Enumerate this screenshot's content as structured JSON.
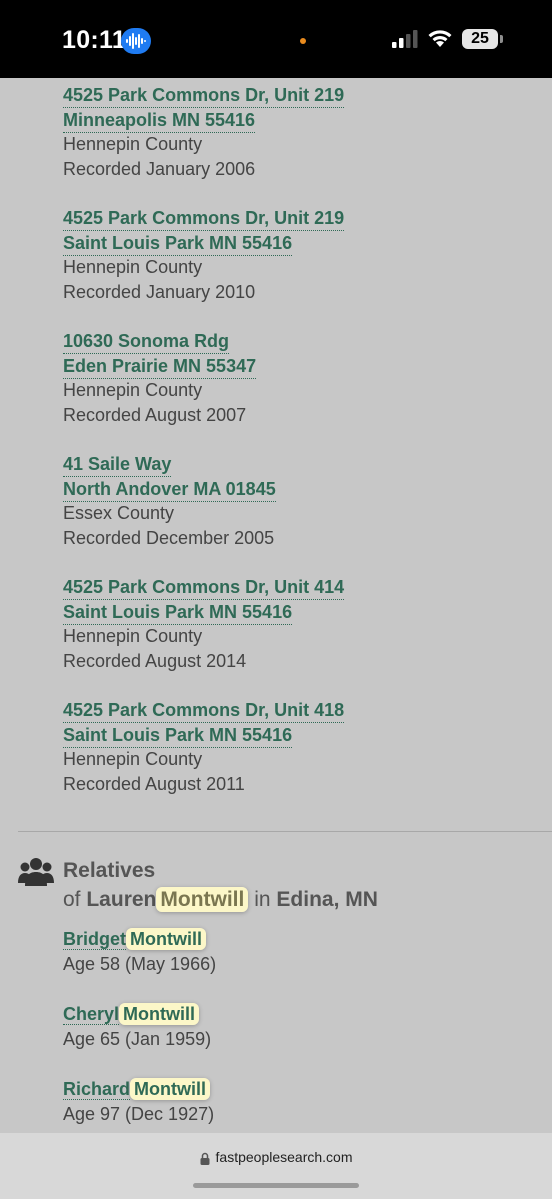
{
  "status_bar": {
    "time": "10:11",
    "battery": "25",
    "accent_color": "#1f7bf2"
  },
  "addresses": [
    {
      "line1": "4525 Park Commons Dr, Unit 219",
      "line2": "Minneapolis MN 55416",
      "county": "Hennepin County",
      "recorded": "Recorded January 2006"
    },
    {
      "line1": "4525 Park Commons Dr, Unit 219",
      "line2": "Saint Louis Park MN 55416",
      "county": "Hennepin County",
      "recorded": "Recorded January 2010"
    },
    {
      "line1": "10630 Sonoma Rdg",
      "line2": "Eden Prairie MN 55347",
      "county": "Hennepin County",
      "recorded": "Recorded August 2007"
    },
    {
      "line1": "41 Saile Way",
      "line2": "North Andover MA 01845",
      "county": "Essex County",
      "recorded": "Recorded December 2005"
    },
    {
      "line1": "4525 Park Commons Dr, Unit 414",
      "line2": "Saint Louis Park MN 55416",
      "county": "Hennepin County",
      "recorded": "Recorded August 2014"
    },
    {
      "line1": "4525 Park Commons Dr, Unit 418",
      "line2": "Saint Louis Park MN 55416",
      "county": "Hennepin County",
      "recorded": "Recorded August 2011"
    }
  ],
  "relatives_section": {
    "title": "Relatives",
    "sub_prefix": "of",
    "first_name": "Lauren",
    "last_name": "Montwill",
    "sub_mid": "in",
    "location": "Edina, MN"
  },
  "relatives": [
    {
      "first": "Bridget",
      "last": "Montwill",
      "age": "Age 58 (May 1966)"
    },
    {
      "first": "Cheryl",
      "last": "Montwill",
      "age": "Age 65 (Jan 1959)"
    },
    {
      "first": "Richard",
      "last": "Montwill",
      "age": "Age 97 (Dec 1927)"
    }
  ],
  "browser": {
    "url": "fastpeoplesearch.com"
  },
  "colors": {
    "link_green": "#2f6a56",
    "highlight": "#fcf7c8",
    "page_bg": "#c7c7c7"
  }
}
